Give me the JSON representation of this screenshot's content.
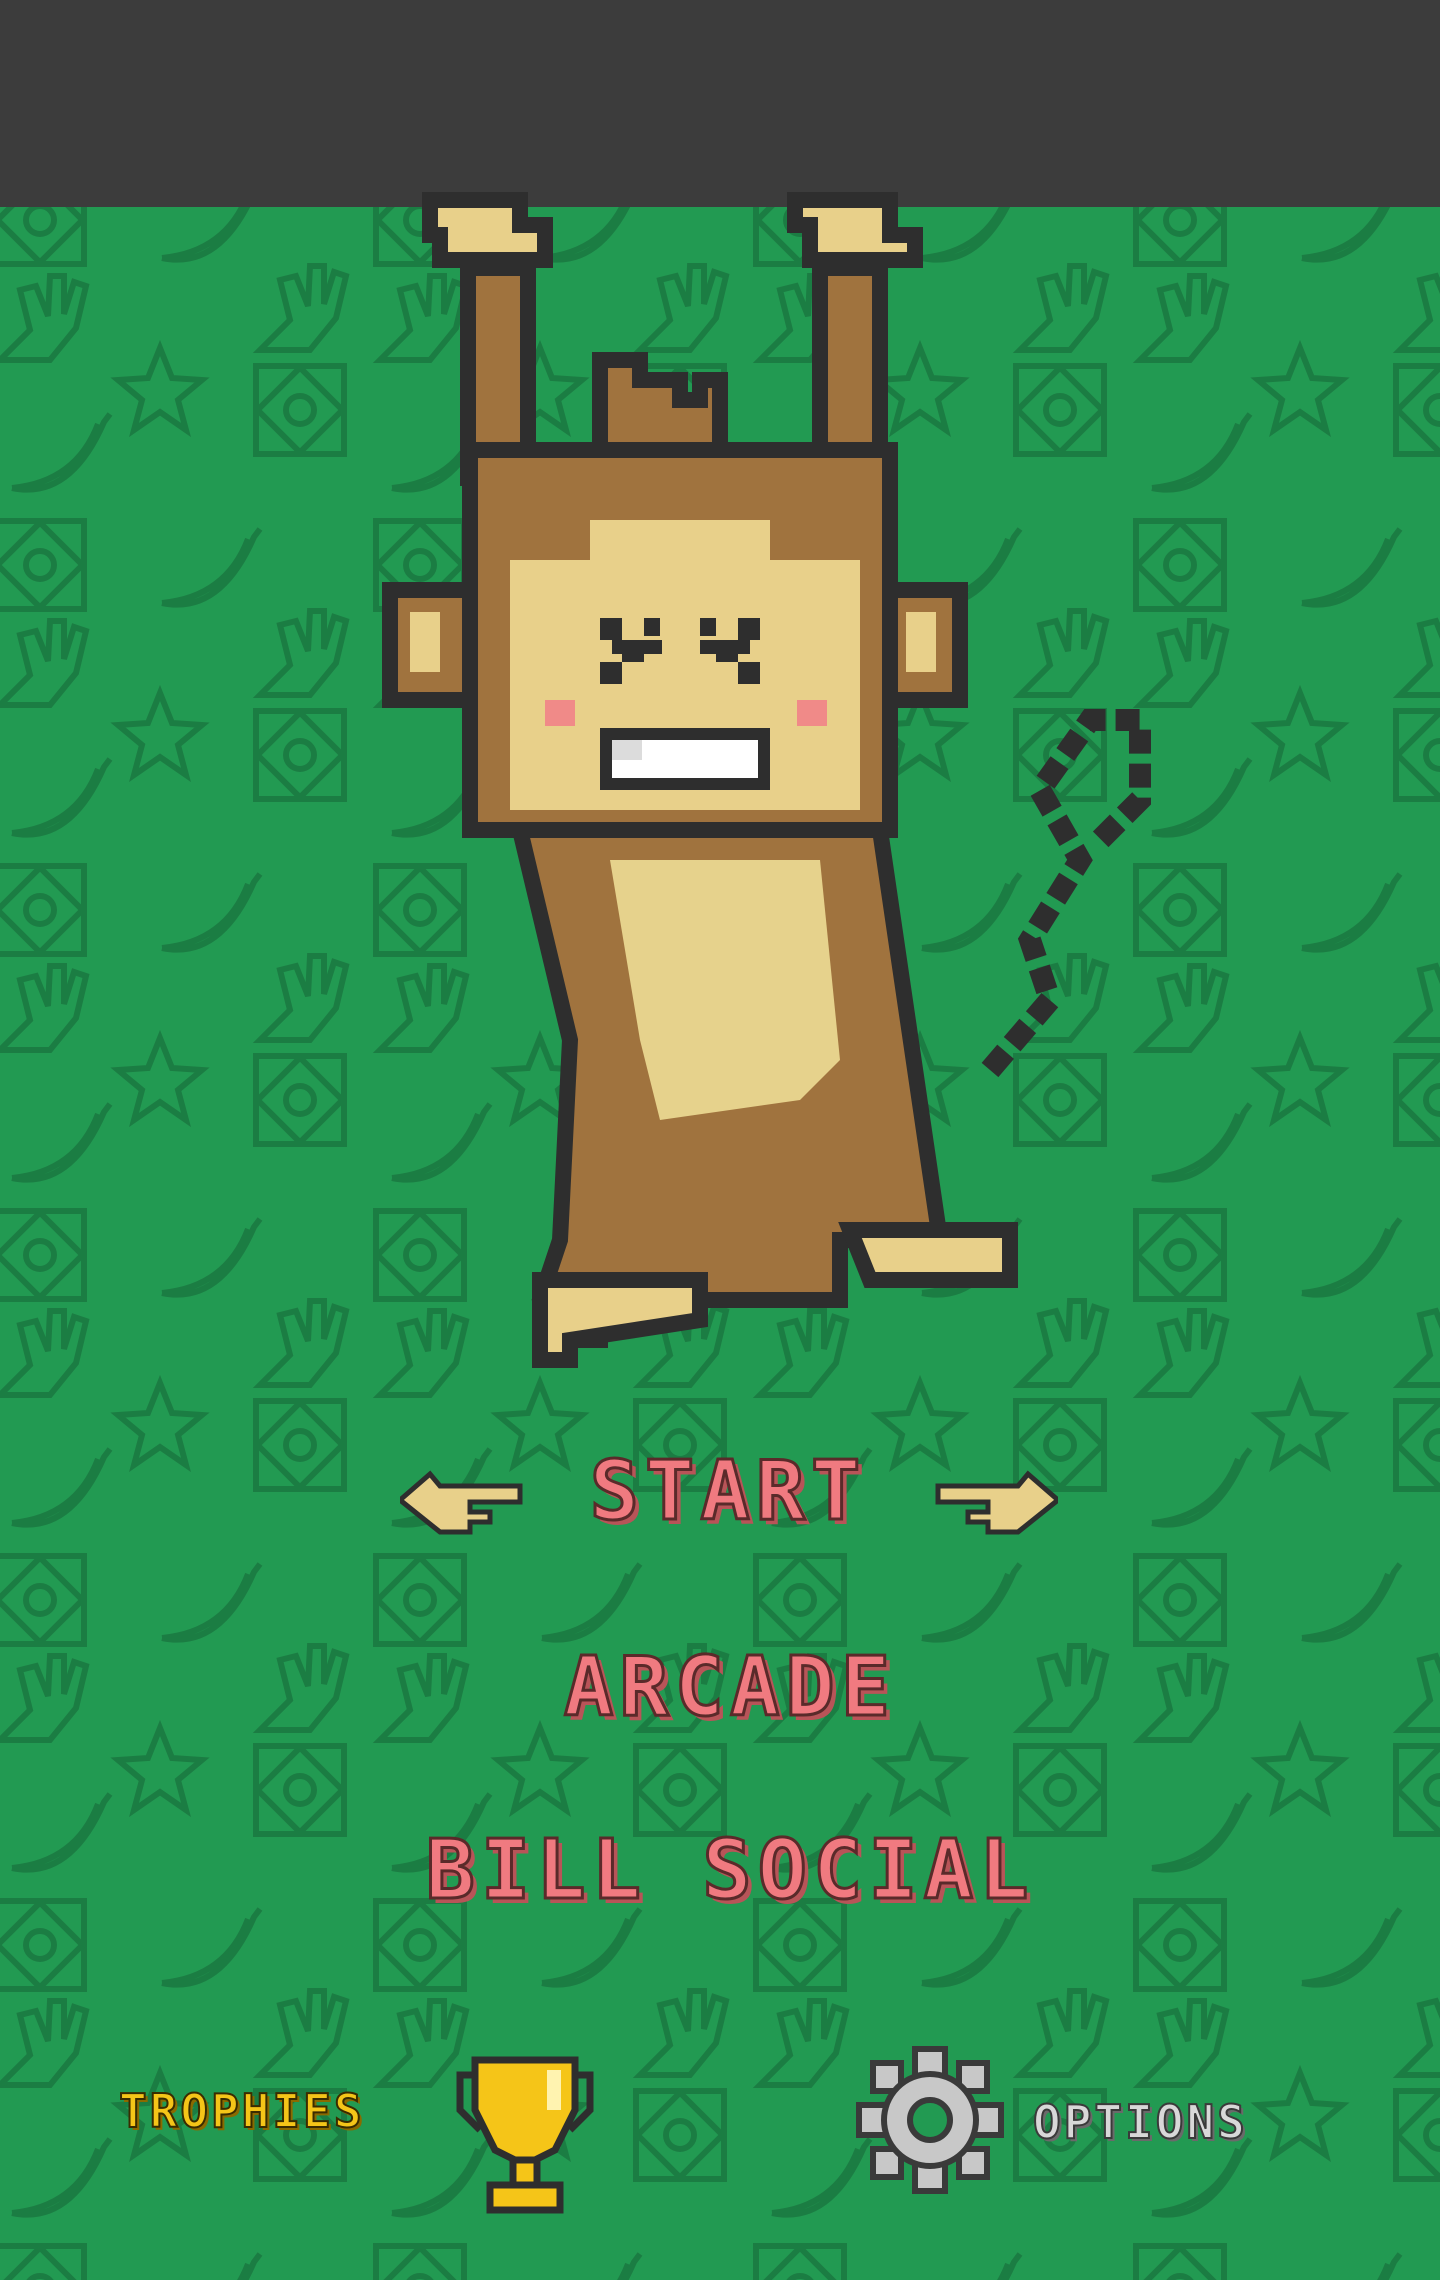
{
  "menu": {
    "start_label": "START",
    "arcade_label": "ARCADE",
    "social_label": "BILL SOCIAL"
  },
  "footer": {
    "trophies_label": "TROPHIES",
    "options_label": "OPTIONS"
  },
  "icons": {
    "background_pattern": [
      "gear-icon",
      "banana-icon",
      "hand-icon",
      "star-icon"
    ],
    "left_pointer": "pointing-hand-left-icon",
    "right_pointer": "pointing-hand-right-icon",
    "trophy": "trophy-icon",
    "options": "gear-icon"
  },
  "colors": {
    "background": "#229a52",
    "pattern": "#1e8447",
    "top_bar": "#3c3c3c",
    "menu_text": "#f07a80",
    "trophies_text": "#f5c518",
    "options_text": "#d8d8d8",
    "monkey_fur": "#a0733e",
    "monkey_face": "#e8d08a"
  }
}
